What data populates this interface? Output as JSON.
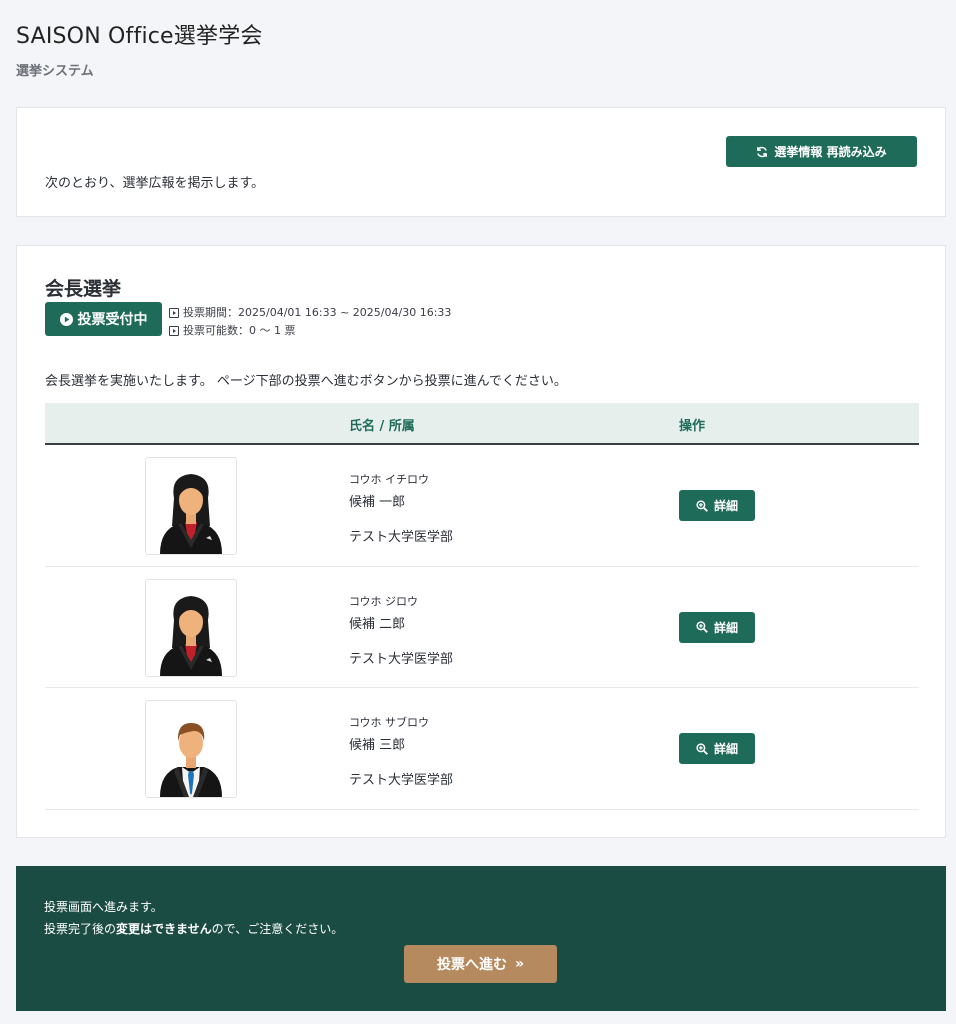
{
  "header": {
    "title": "SAISON Office選挙学会",
    "subtitle": "選挙システム"
  },
  "notice": {
    "text": "次のとおり、選挙広報を掲示します。",
    "reload_label": "選挙情報 再読み込み"
  },
  "election": {
    "title": "会長選挙",
    "status": "投票受付中",
    "period": "投票期間：2025/04/01 16:33 ~ 2025/04/30 16:33",
    "vote_count": "投票可能数：0 〜 1 票",
    "description": "会長選挙を実施いたします。 ページ下部の投票へ進むボタンから投票に進んでください。",
    "columns": {
      "name": "氏名 / 所属",
      "ops": "操作"
    },
    "candidates": [
      {
        "kana": "コウホ イチロウ",
        "name": "候補 一郎",
        "affiliation": "テスト大学医学部",
        "detail_label": "詳細",
        "avatar": "female-avatar"
      },
      {
        "kana": "コウホ ジロウ",
        "name": "候補 二郎",
        "affiliation": "テスト大学医学部",
        "detail_label": "詳細",
        "avatar": "female-avatar"
      },
      {
        "kana": "コウホ サブロウ",
        "name": "候補 三郎",
        "affiliation": "テスト大学医学部",
        "detail_label": "詳細",
        "avatar": "male-avatar"
      }
    ]
  },
  "footer": {
    "line1": "投票画面へ進みます。",
    "line2_before": "投票完了後の",
    "line2_bold": "変更はできません",
    "line2_after": "ので、ご注意ください。",
    "vote_label": "投票へ進む"
  },
  "colors": {
    "primary": "#1f6b59",
    "footer_bg": "#1b4c43",
    "vote_button": "#b48a5e"
  }
}
